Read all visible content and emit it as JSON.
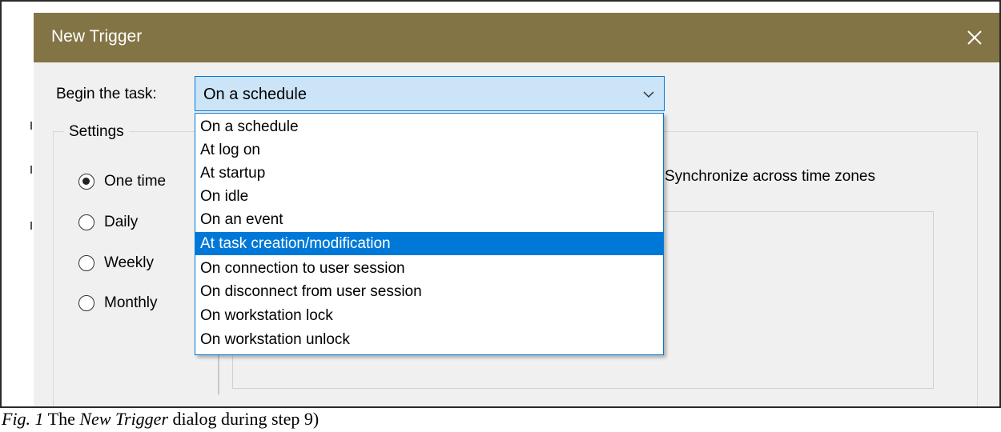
{
  "dialog": {
    "title": "New Trigger",
    "close_icon": "close-icon",
    "title_bar_color": "#827444"
  },
  "begin": {
    "label": "Begin the task:",
    "selected_value": "On a schedule",
    "chevron_icon": "chevron-down-icon",
    "options": [
      "On a schedule",
      "At log on",
      "At startup",
      "On idle",
      "On an event",
      "At task creation/modification",
      "On connection to user session",
      "On disconnect from user session",
      "On workstation lock",
      "On workstation unlock"
    ],
    "highlighted_option": "At task creation/modification"
  },
  "settings": {
    "legend": "Settings",
    "radios": [
      {
        "label": "One time",
        "checked": true
      },
      {
        "label": "Daily",
        "checked": false
      },
      {
        "label": "Weekly",
        "checked": false
      },
      {
        "label": "Monthly",
        "checked": false
      }
    ],
    "sync_label": "Synchronize across time zones"
  },
  "caption": {
    "fig": "Fig. 1",
    "text_before": " The ",
    "emph": "New Trigger",
    "text_after": " dialog during step 9)"
  }
}
